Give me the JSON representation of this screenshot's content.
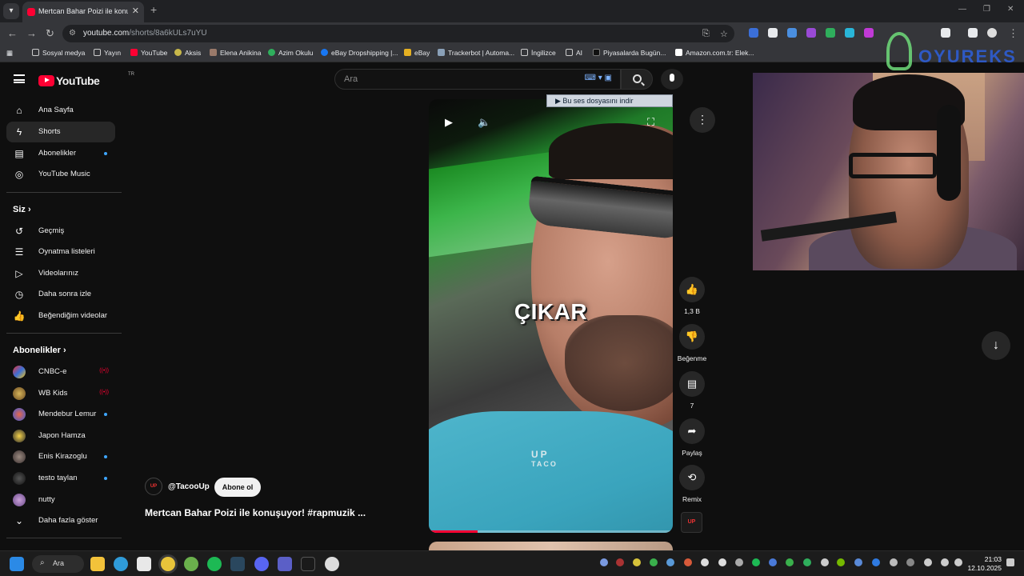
{
  "browser": {
    "tab_title": "Mertcan Bahar Poizi ile konuşuy",
    "url_host": "youtube.com",
    "url_path": "/shorts/8a6kULs7uYU",
    "bookmarks": [
      "Sosyal medya",
      "Yayın",
      "YouTube",
      "Aksis",
      "Elena Anikina",
      "Azim Okulu",
      "eBay Dropshipping |...",
      "eBay",
      "Trackerbot | Automa...",
      "İngilizce",
      "AI",
      "Piyasalarda Bugün...",
      "Amazon.com.tr: Elek..."
    ]
  },
  "youtube": {
    "logo_text": "YouTube",
    "region": "TR",
    "search_placeholder": "Ara",
    "nav": [
      {
        "label": "Ana Sayfa"
      },
      {
        "label": "Shorts"
      },
      {
        "label": "Abonelikler"
      },
      {
        "label": "YouTube Music"
      }
    ],
    "you_heading": "Siz",
    "you_items": [
      {
        "label": "Geçmiş"
      },
      {
        "label": "Oynatma listeleri"
      },
      {
        "label": "Videolarınız"
      },
      {
        "label": "Daha sonra izle"
      },
      {
        "label": "Beğendiğim videolar"
      }
    ],
    "subs_heading": "Abonelikler",
    "subscriptions": [
      {
        "label": "CNBC-e"
      },
      {
        "label": "WB Kids"
      },
      {
        "label": "Mendebur Lemur"
      },
      {
        "label": "Japon Hamza"
      },
      {
        "label": "Enis Kirazoglu"
      },
      {
        "label": "testo taylan"
      },
      {
        "label": "nutty"
      }
    ],
    "show_more": "Daha fazla göster"
  },
  "short": {
    "caption": "ÇIKAR",
    "brand_line1": "UP",
    "brand_line2": "TACO",
    "progress": 0.2,
    "download_banner": "Bu ses dosyasını indir",
    "channel_handle": "@TacooUp",
    "subscribe_label": "Abone ol",
    "title": "Mertcan Bahar Poizi ile konuşuyor! #rapmuzik ...",
    "likes": "1,3 B",
    "dislike_label": "Beğenme",
    "comments": "7",
    "share_label": "Paylaş",
    "remix_label": "Remix"
  },
  "overlay": {
    "watermark_text": "OYUREKS"
  },
  "taskbar": {
    "search_label": "Ara",
    "time": "21:03",
    "date": "12.10.2025"
  },
  "colors": {
    "brand_red": "#ff0033",
    "background": "#0f0f0f",
    "accent_blue": "#3ea6ff"
  }
}
